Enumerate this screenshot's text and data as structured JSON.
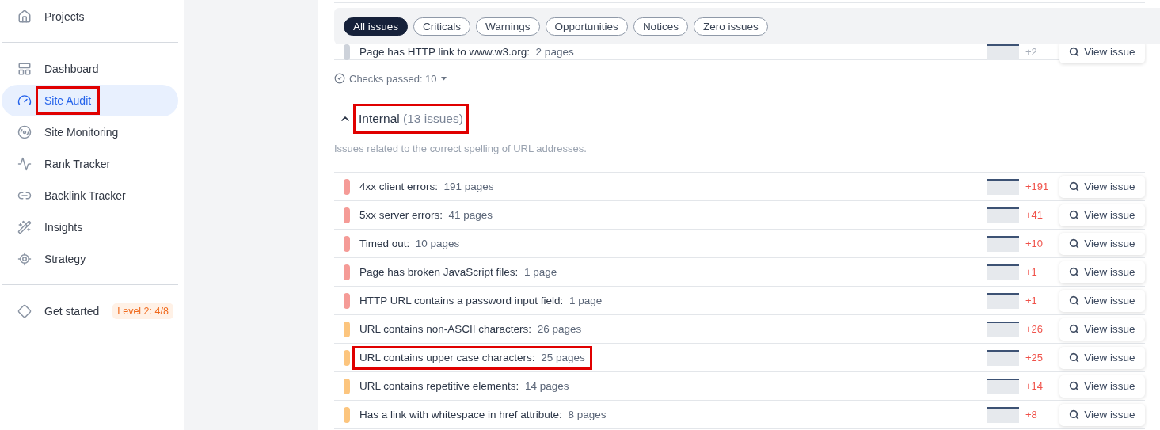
{
  "sidebar": {
    "groups": [
      [
        {
          "label": "Projects",
          "selected": false,
          "highlighted": false
        }
      ],
      [
        {
          "label": "Dashboard",
          "selected": false,
          "highlighted": false
        },
        {
          "label": "Site Audit",
          "selected": true,
          "highlighted": true
        },
        {
          "label": "Site Monitoring",
          "selected": false,
          "highlighted": false
        },
        {
          "label": "Rank Tracker",
          "selected": false,
          "highlighted": false
        },
        {
          "label": "Backlink Tracker",
          "selected": false,
          "highlighted": false
        },
        {
          "label": "Insights",
          "selected": false,
          "highlighted": false
        },
        {
          "label": "Strategy",
          "selected": false,
          "highlighted": false
        }
      ],
      [
        {
          "label": "Get started",
          "selected": false,
          "highlighted": false,
          "badge": "Level 2: 4/8"
        }
      ]
    ]
  },
  "filters": [
    {
      "label": "All issues",
      "selected": true
    },
    {
      "label": "Criticals",
      "selected": false
    },
    {
      "label": "Warnings",
      "selected": false
    },
    {
      "label": "Opportunities",
      "selected": false
    },
    {
      "label": "Notices",
      "selected": false
    },
    {
      "label": "Zero issues",
      "selected": false
    }
  ],
  "previous_section": {
    "rows": [
      {
        "text": "Page has HTTP link to www.w3.org:",
        "count": "2 pages",
        "kind": "notice",
        "color": "#cdd2da",
        "delta": "+2",
        "button": "View issue"
      }
    ],
    "checks_passed": "Checks passed: 10"
  },
  "section": {
    "title": "Internal",
    "count": "(13 issues)",
    "expanded": true,
    "highlighted": true,
    "description": "Issues related to the correct spelling of URL addresses.",
    "rows": [
      {
        "text": "4xx client errors:",
        "count": "191 pages",
        "kind": "issue",
        "color": "#f59b97",
        "delta": "+191",
        "button": "View issue",
        "highlighted": false
      },
      {
        "text": "5xx server errors:",
        "count": "41 pages",
        "kind": "issue",
        "color": "#f59b97",
        "delta": "+41",
        "button": "View issue",
        "highlighted": false
      },
      {
        "text": "Timed out:",
        "count": "10 pages",
        "kind": "issue",
        "color": "#f59b97",
        "delta": "+10",
        "button": "View issue",
        "highlighted": false
      },
      {
        "text": "Page has broken JavaScript files:",
        "count": "1 page",
        "kind": "issue",
        "color": "#f59b97",
        "delta": "+1",
        "button": "View issue",
        "highlighted": false
      },
      {
        "text": "HTTP URL contains a password input field:",
        "count": "1 page",
        "kind": "issue",
        "color": "#f59b97",
        "delta": "+1",
        "button": "View issue",
        "highlighted": false
      },
      {
        "text": "URL contains non-ASCII characters:",
        "count": "26 pages",
        "kind": "issue",
        "color": "#fcc57e",
        "delta": "+26",
        "button": "View issue",
        "highlighted": false
      },
      {
        "text": "URL contains upper case characters:",
        "count": "25 pages",
        "kind": "issue",
        "color": "#fcc57e",
        "delta": "+25",
        "button": "View issue",
        "highlighted": true
      },
      {
        "text": "URL contains repetitive elements:",
        "count": "14 pages",
        "kind": "issue",
        "color": "#fcc57e",
        "delta": "+14",
        "button": "View issue",
        "highlighted": false
      },
      {
        "text": "Has a link with whitespace in href attribute:",
        "count": "8 pages",
        "kind": "issue",
        "color": "#fcc57e",
        "delta": "+8",
        "button": "View issue",
        "highlighted": false
      }
    ]
  }
}
